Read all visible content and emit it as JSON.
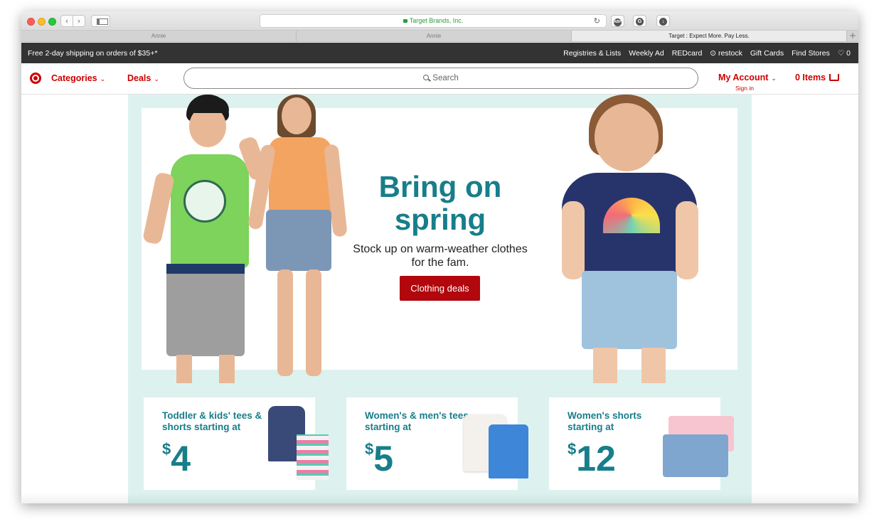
{
  "browser": {
    "url_text": "Target Brands, Inc.",
    "tabs": [
      "Annie",
      "Annie",
      "Target : Expect More. Pay Less."
    ],
    "ext_labels": [
      "ABP",
      "G",
      "↓"
    ]
  },
  "promo": {
    "shipping": "Free 2-day shipping on orders of $35+*",
    "links": [
      "Registries & Lists",
      "Weekly Ad",
      "REDcard",
      "⊙ restock",
      "Gift Cards",
      "Find Stores",
      "♡ 0"
    ]
  },
  "header": {
    "categories": "Categories",
    "deals": "Deals",
    "search_placeholder": "Search",
    "account": "My Account",
    "signin": "Sign in",
    "cart": "0 Items"
  },
  "hero": {
    "title": "Bring on spring",
    "subtitle": "Stock up on warm-weather clothes for the fam.",
    "button": "Clothing deals"
  },
  "cards": [
    {
      "title": "Toddler & kids' tees & shorts starting at",
      "currency": "$",
      "price": "4"
    },
    {
      "title": "Women's & men's tees starting at",
      "currency": "$",
      "price": "5"
    },
    {
      "title": "Women's shorts starting at",
      "currency": "$",
      "price": "12"
    }
  ],
  "colors": {
    "brand_red": "#cc0000",
    "button_red": "#b1070d",
    "teal_text": "#177e8a",
    "stage_bg": "#ddf2ef",
    "promo_bg": "#333333"
  },
  "icons": [
    "target-logo-icon",
    "chevron-down-icon",
    "search-icon",
    "cart-icon",
    "lock-icon",
    "heart-icon"
  ]
}
